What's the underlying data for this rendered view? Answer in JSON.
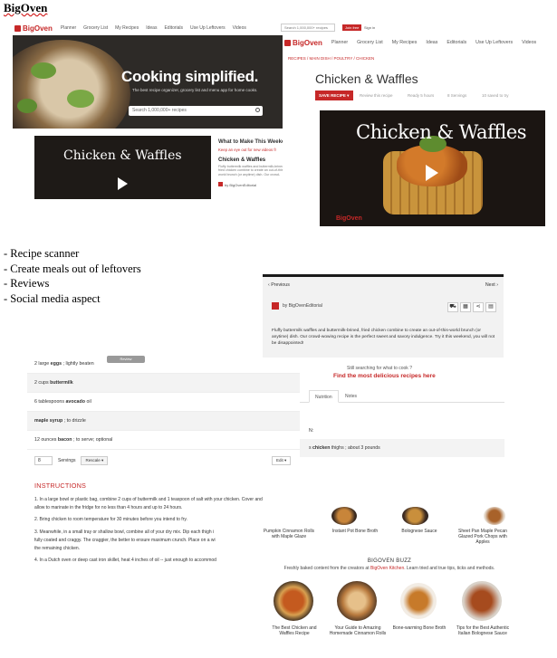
{
  "doc_title": "BigOven",
  "bullets": [
    "- Recipe scanner",
    "- Create meals out of leftovers",
    "- Reviews",
    "- Social media aspect"
  ],
  "brand": {
    "name": "BigOven",
    "color": "#c62828"
  },
  "nav": [
    "Planner",
    "Grocery List",
    "My Recipes",
    "Ideas",
    "Editorials",
    "Use Up Leftovers",
    "Videos"
  ],
  "home": {
    "hero_title": "Cooking simplified.",
    "hero_sub": "The best recipe organizer, grocery list and menu app for home cooks.",
    "search_placeholder": "Search 1,000,000+ recipes"
  },
  "what_to_make": {
    "heading": "What to Make This Weekend",
    "keep_eye": "Keep an eye out for new videos fr",
    "video_title": "Chicken & Waffles",
    "card_title": "Chicken & Waffles",
    "card_desc": "Fluffy buttermilk waffles and buttermilk-brined fried chicken combine to create an out-of-this-world brunch (or anytime) dish. Our crowd-",
    "by": "by BigOvenEditorial"
  },
  "recipe": {
    "top_search": "Search 1,000,000+ recipes",
    "signup": "Join free",
    "signin": "Sign in",
    "breadcrumb": "RECIPES / MAIN DISH / POULTRY / CHICKEN",
    "title": "Chicken & Waffles",
    "save_label": "SAVE RECIPE ▾",
    "meta": [
      "Review this recipe",
      "Ready 5 hours",
      "8 Servings",
      "10 saved to try"
    ],
    "video_title": "Chicken & Waffles",
    "watermark": "BigOven"
  },
  "editorial": {
    "prev": "‹ Previous",
    "next": "Next ›",
    "by": "by BigOvenEditorial",
    "description": "Fluffy buttermilk waffles and buttermilk-brined, fried chicken combine to create an out-of-this-world brunch (or anytime) dish. Our crowd-wowing recipe is the perfect sweet and savory indulgence. Try it this weekend, you will not be disappointed!"
  },
  "ingredients": [
    {
      "pre": "2 large ",
      "bold": "eggs",
      "post": " ; lightly beaten"
    },
    {
      "pre": "2 cups ",
      "bold": "buttermilk",
      "post": ""
    },
    {
      "pre": "6 tablespoons ",
      "bold": "avocado",
      "post": " oil"
    },
    {
      "pre": "",
      "bold": "maple syrup",
      "post": " ; to drizzle"
    },
    {
      "pre": "12 ounces ",
      "bold": "bacon",
      "post": " ; to serve; optional"
    }
  ],
  "review_pill": "Review",
  "servings": {
    "value": "8",
    "label": "Servings",
    "rescale": "Rescale ▾",
    "edit": "Edit ▾"
  },
  "instructions": {
    "heading": "INSTRUCTIONS",
    "steps": [
      "1. In a large bowl or plastic bag, combine 2 cups of buttermilk and 1 teaspoon of salt with your chicken. Cover and",
      "allow to marinate in the fridge for no less than 4 hours and up to 24 hours.",
      "2. Bring chicken to room temperature for 30 minutes before you intend to fry.",
      "3. Meanwhile, in a small tray or shallow bowl, combine all of your dry mix. Dip each thigh i",
      "fully coated and craggy. The craggier, the better to ensure maximum crunch. Place on a wi",
      "the remaining chicken.",
      "4. In a Dutch oven or deep cast iron skillet, heat 4 inches of oil -- just enough to accommod"
    ]
  },
  "search_more": {
    "still": "Still searching for what to cook ?",
    "find": "Find the most delicious recipes here",
    "tabs": [
      "Nutrition",
      "Notes"
    ],
    "row1": "N:",
    "row2_pre": "s ",
    "row2_bold": "chicken",
    "row2_post": " thighs ; about 3 pounds"
  },
  "recommendations": [
    "Pumpkin Cinnamon Rolls with Maple Glaze",
    "Instant Pot Bone Broth",
    "Bolognese Sauce",
    "Sheet Pan Maple Pecan Glazed Pork Chops with Apples"
  ],
  "buzz": {
    "heading": "BIGOVEN BUZZ",
    "sub_pre": "Freshly baked content from the creators at ",
    "sub_link": "BigOven Kitchen",
    "sub_post": ". Learn tried and true tips, ticks and methods.",
    "items": [
      "The Best Chicken and Waffles Recipe",
      "Your Guide to Amazing Homemade Cinnamon Rolls",
      "Bone-warming Bone Broth",
      "Tips for the Best Authentic Italian Bolognese Sauce"
    ]
  }
}
